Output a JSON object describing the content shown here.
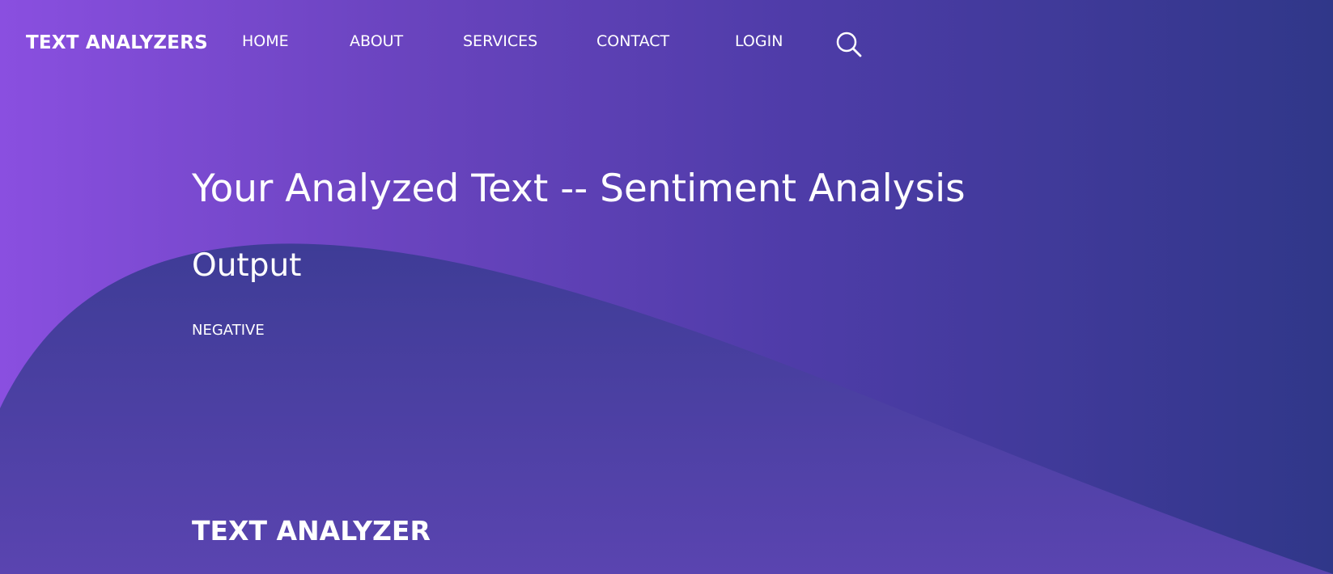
{
  "nav": {
    "brand": "TEXT ANALYZERS",
    "links": [
      {
        "label": "HOME"
      },
      {
        "label": "ABOUT"
      },
      {
        "label": "SERVICES"
      },
      {
        "label": "CONTACT"
      },
      {
        "label": "LOGIN"
      }
    ],
    "search_icon": "search-icon"
  },
  "main": {
    "title": "Your Analyzed Text -- Sentiment Analysis",
    "subtitle": "Output",
    "result": "NEGATIVE"
  },
  "footer": {
    "title": "TEXT ANALYZER"
  },
  "colors": {
    "gradient_start": "#8a4fe0",
    "gradient_end": "#303789",
    "wave_top": "#3e3d98",
    "wave_bottom": "#5c44b0",
    "text": "#ffffff"
  }
}
